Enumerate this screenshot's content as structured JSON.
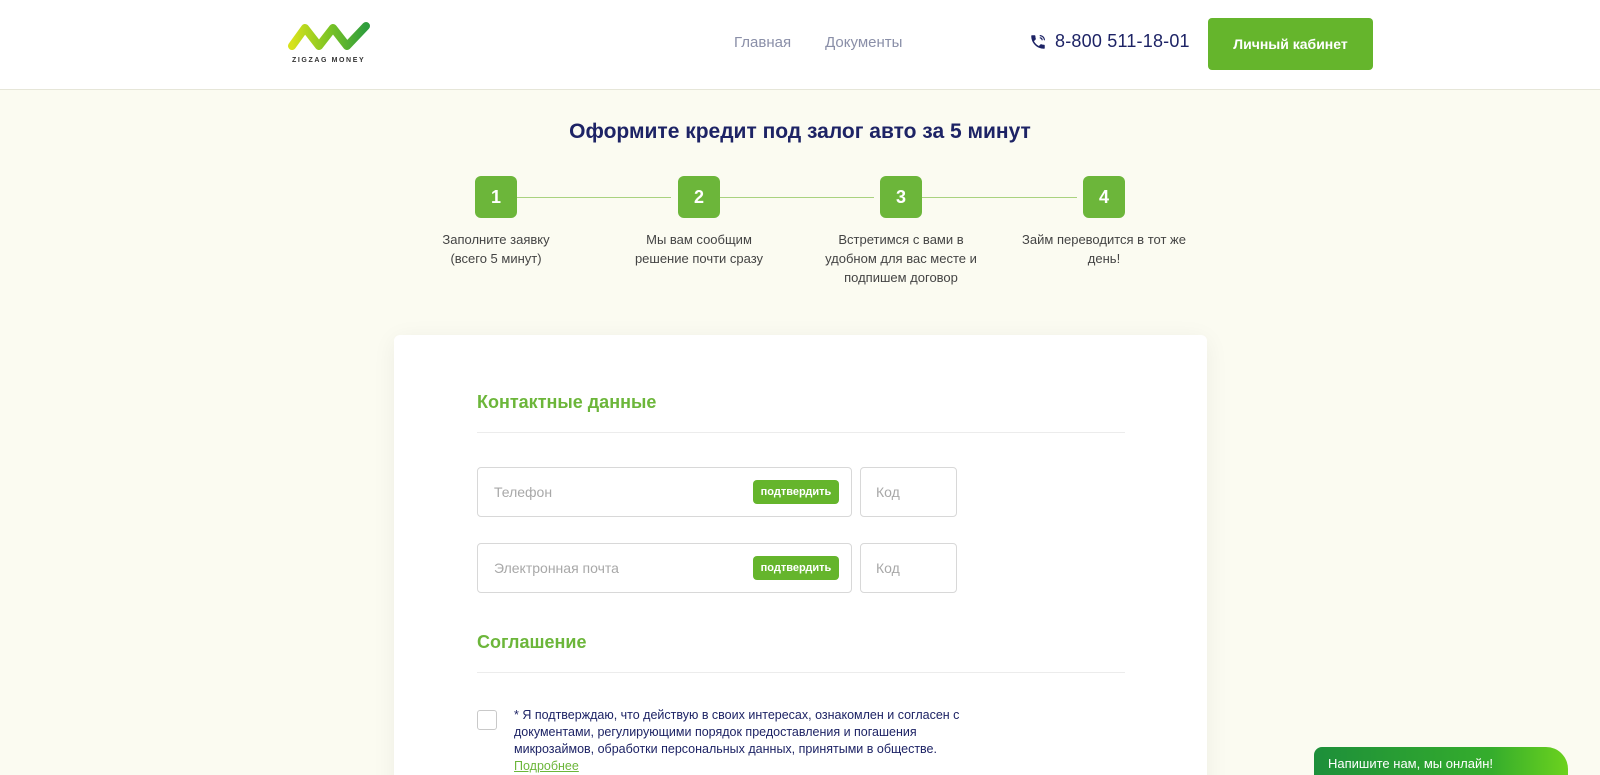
{
  "header": {
    "logo_text": "ZIGZAG MONEY",
    "nav": [
      "Главная",
      "Документы"
    ],
    "phone": "8-800 511-18-01",
    "cabinet_button": "Личный кабинет"
  },
  "title": "Оформите кредит под залог авто за 5 минут",
  "steps": [
    {
      "number": "1",
      "text": "Заполните заявку (всего 5 минут)"
    },
    {
      "number": "2",
      "text": "Мы вам сообщим решение почти сразу"
    },
    {
      "number": "3",
      "text": "Встретимся с вами в удобном для вас месте и подпишем договор"
    },
    {
      "number": "4",
      "text": "Займ переводится в тот же день!"
    }
  ],
  "form": {
    "contacts_title": "Контактные данные",
    "phone_placeholder": "Телефон",
    "email_placeholder": "Электронная почта",
    "confirm_label": "подтвердить",
    "code_placeholder": "Код",
    "agreement_title": "Соглашение",
    "agreement_text": "* Я подтверждаю, что действую в своих интересах, ознакомлен и согласен с документами, регулирующими порядок предоставления и погашения микрозаймов, обработки персональных данных, принятыми в обществе.",
    "agreement_more": "Подробнее"
  },
  "chat": {
    "label": "Напишите нам, мы онлайн!"
  },
  "colors": {
    "accent": "#65b52c",
    "navy": "#1d2365",
    "page_bg": "#fbfbf1"
  }
}
